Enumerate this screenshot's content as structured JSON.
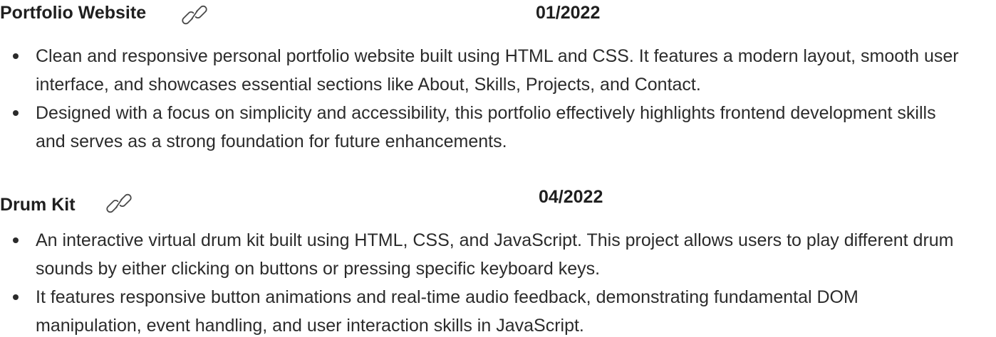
{
  "projects": [
    {
      "title": "Portfolio Website",
      "link_icon": "link-icon",
      "date": "01/2022",
      "bullets": [
        "Clean and responsive personal portfolio website built using HTML and CSS. It features a modern layout, smooth user interface, and showcases essential sections like About, Skills, Projects, and Contact.",
        "Designed with a focus on simplicity and accessibility, this portfolio effectively highlights frontend development skills and serves as a strong foundation for future enhancements."
      ]
    },
    {
      "title": "Drum Kit",
      "link_icon": "link-icon",
      "date": "04/2022",
      "bullets": [
        "An interactive virtual drum kit built using HTML, CSS, and JavaScript. This project allows users to play different drum sounds by either clicking on buttons or pressing specific keyboard keys.",
        " It features responsive button animations and real-time audio feedback, demonstrating fundamental DOM manipulation, event handling, and user interaction skills in JavaScript."
      ]
    }
  ]
}
